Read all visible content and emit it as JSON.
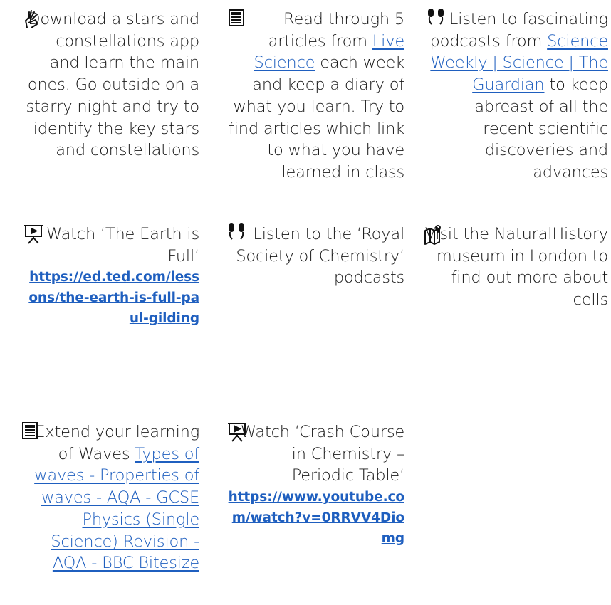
{
  "activities": [
    {
      "icon": "sign-language-hand-icon",
      "text_before": "Download a stars and constellations app and learn the main ones. Go outside on a starry night and try to identify the key stars and constellations"
    },
    {
      "icon": "newspaper-icon",
      "text_before": "Read through 5 articles from ",
      "link_text": "Live Science",
      "text_after": " each week and keep a diary of what you learn. Try to find articles which link to what you have learned in class"
    },
    {
      "icon": "earbuds-icon",
      "text_before": "Listen to fascinating podcasts from ",
      "link_text": "Science Weekly | Science | The Guardian",
      "text_after": " to keep abreast of all the recent scientific discoveries and advances"
    },
    {
      "icon": "presentation-screen-icon",
      "text_before": "Watch ‘The Earth is Full’",
      "url": "https://ed.ted.com/lessons/the-earth-is-full-paul-gilding"
    },
    {
      "icon": "earbuds-icon",
      "text_before": "Listen to the ‘Royal Society of Chemistry’ podcasts"
    },
    {
      "icon": "map-pin-icon",
      "text_before": "Visit the NaturalHistory museum in London to find out more about cells"
    },
    {
      "icon": "newspaper-icon",
      "text_before": "Extend your learning of Waves ",
      "link_text": "Types of waves - Properties of waves - AQA - GCSE Physics (Single Science) Revision - AQA - BBC Bitesize"
    },
    {
      "icon": "presentation-screen-icon",
      "text_before": "Watch ‘Crash Course in Chemistry – Periodic Table’",
      "url": "https://www.youtube.com/watch?v=0RRVV4Diomg"
    }
  ]
}
